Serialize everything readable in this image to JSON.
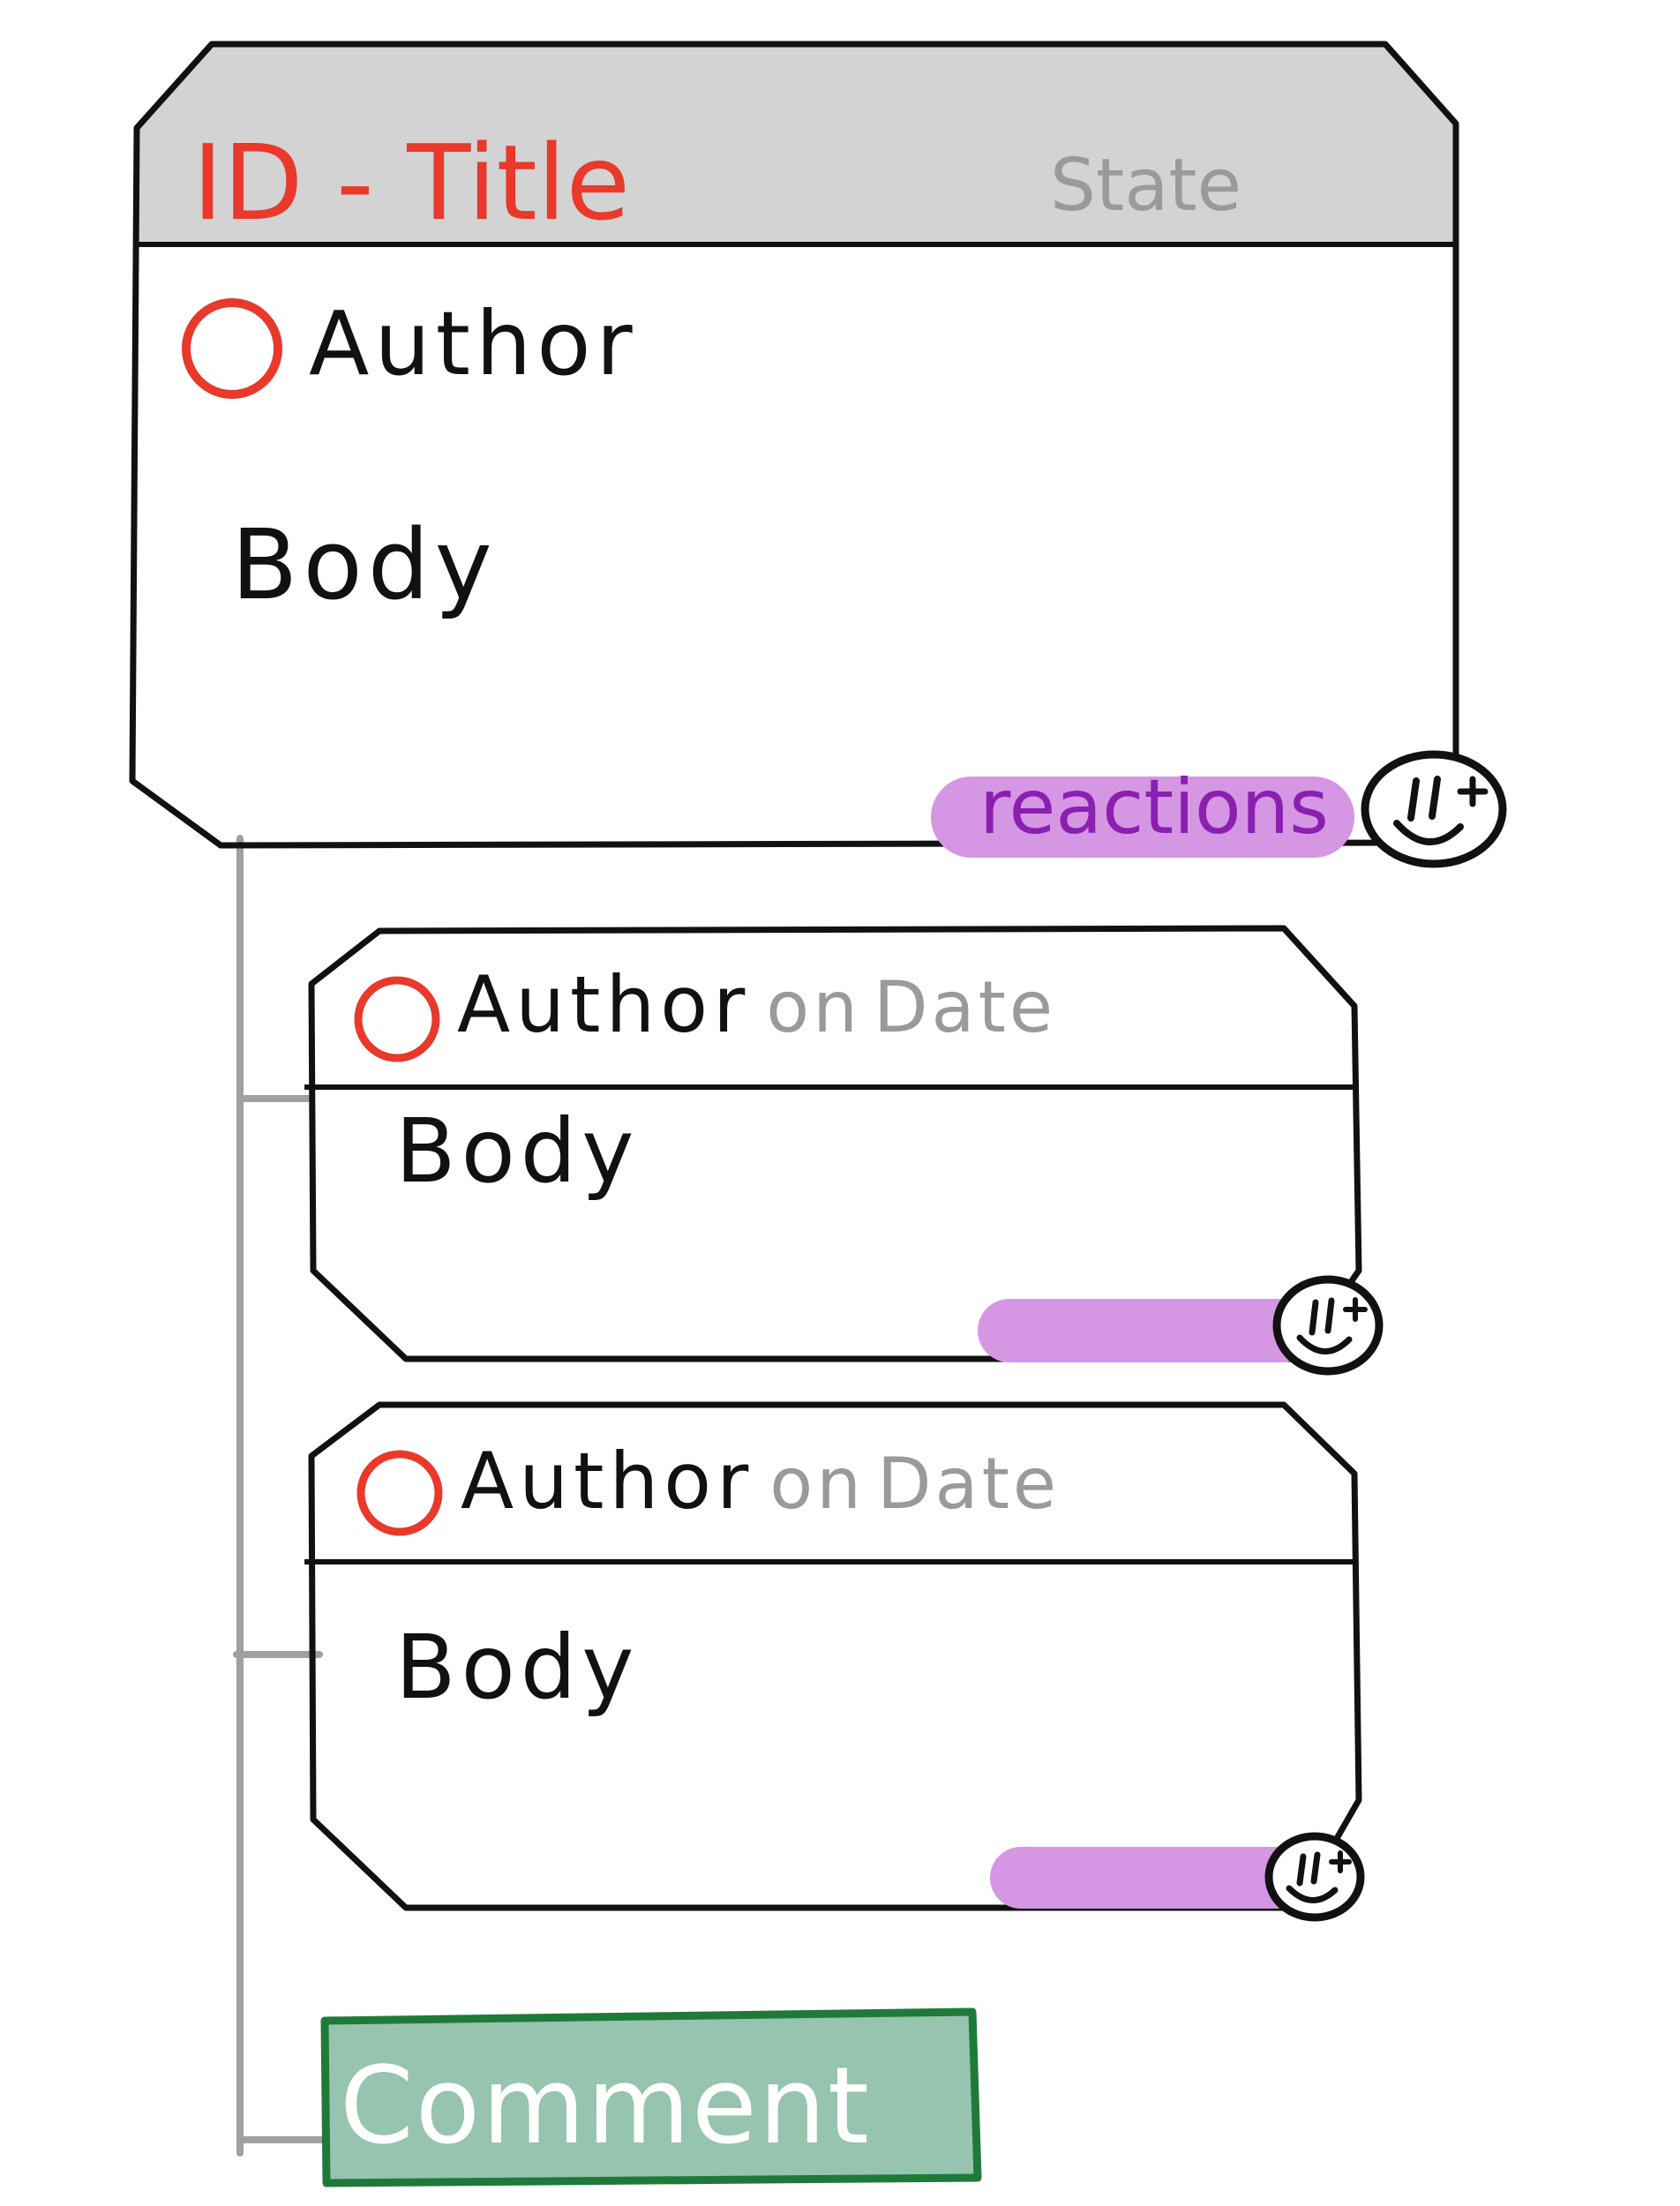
{
  "issue": {
    "id_title": "ID - Title",
    "state": "State",
    "author": "Author",
    "body": "Body",
    "reactions_label": "reactions",
    "reaction_icon": "smiley-plus-icon"
  },
  "comments": [
    {
      "author": "Author",
      "on": "on",
      "date": "Date",
      "body": "Body",
      "reaction_icon": "smiley-plus-icon"
    },
    {
      "author": "Author",
      "on": "on",
      "date": "Date",
      "body": "Body",
      "reaction_icon": "smiley-plus-icon"
    }
  ],
  "comment_button": {
    "label": "Comment"
  },
  "colors": {
    "title": "#e8392b",
    "avatar": "#e8392b",
    "state": "#9a9a9a",
    "header_bg": "#d3d3d3",
    "reactions_highlight": "#d596e3",
    "reactions_text": "#8a1fb0",
    "comment_button_fill": "#96c4ae",
    "comment_button_border": "#1f7a3a",
    "connector": "#a0a0a0"
  }
}
